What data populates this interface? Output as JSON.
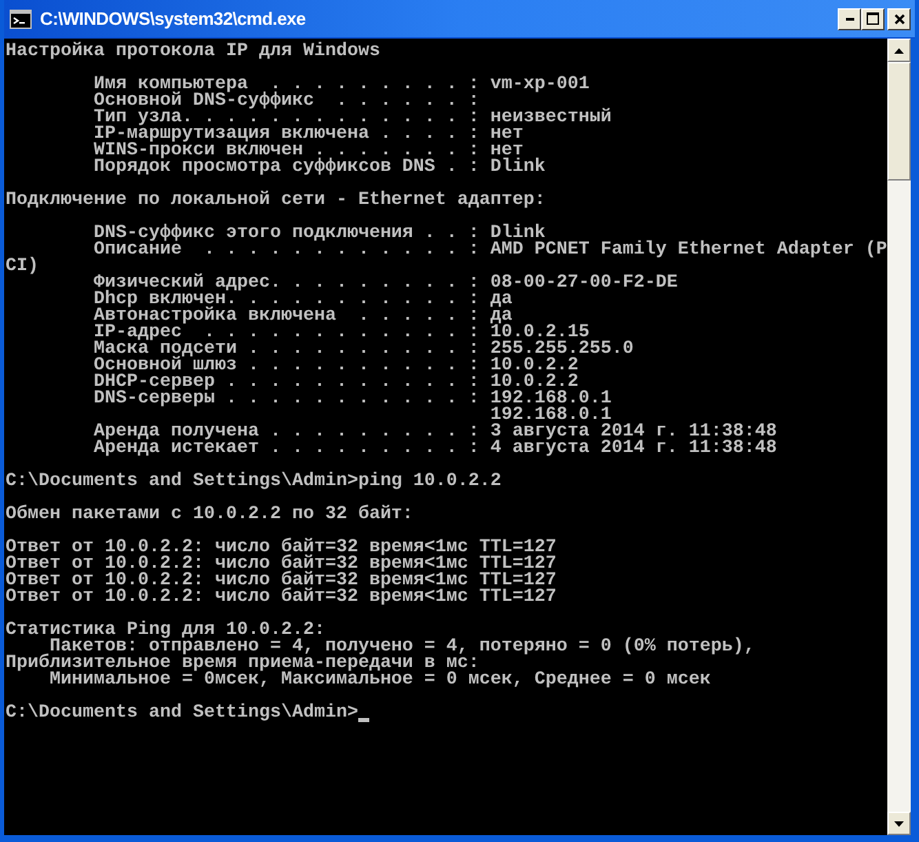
{
  "window": {
    "title": "C:\\WINDOWS\\system32\\cmd.exe"
  },
  "console": {
    "blocks": [
      [
        "Настройка протокола IP для Windows"
      ],
      [
        "        Имя компьютера  . . . . . . . . . : vm-xp-001",
        "        Основной DNS-суффикс  . . . . . . :",
        "        Тип узла. . . . . . . . . . . . . : неизвестный",
        "        IP-маршрутизация включена . . . . : нет",
        "        WINS-прокси включен . . . . . . . : нет",
        "        Порядок просмотра суффиксов DNS . : Dlink"
      ],
      [
        "Подключение по локальной сети - Ethernet адаптер:"
      ],
      [
        "        DNS-суффикс этого подключения . . : Dlink",
        "        Описание  . . . . . . . . . . . . : AMD PCNET Family Ethernet Adapter (P",
        "CI)",
        "        Физический адрес. . . . . . . . . : 08-00-27-00-F2-DE",
        "        Dhcp включен. . . . . . . . . . . : да",
        "        Автонастройка включена  . . . . . : да",
        "        IP-адрес  . . . . . . . . . . . . : 10.0.2.15",
        "        Маска подсети . . . . . . . . . . : 255.255.255.0",
        "        Основной шлюз . . . . . . . . . . : 10.0.2.2",
        "        DHCP-сервер . . . . . . . . . . . : 10.0.2.2",
        "        DNS-серверы . . . . . . . . . . . : 192.168.0.1",
        "                                            192.168.0.1",
        "        Аренда получена . . . . . . . . . : 3 августа 2014 г. 11:38:48",
        "        Аренда истекает . . . . . . . . . : 4 августа 2014 г. 11:38:48"
      ],
      [
        "C:\\Documents and Settings\\Admin>ping 10.0.2.2"
      ],
      [
        "Обмен пакетами с 10.0.2.2 по 32 байт:"
      ],
      [
        "Ответ от 10.0.2.2: число байт=32 время<1мс TTL=127",
        "Ответ от 10.0.2.2: число байт=32 время<1мс TTL=127",
        "Ответ от 10.0.2.2: число байт=32 время<1мс TTL=127",
        "Ответ от 10.0.2.2: число байт=32 время<1мс TTL=127"
      ],
      [
        "Статистика Ping для 10.0.2.2:",
        "    Пакетов: отправлено = 4, получено = 4, потеряно = 0 (0% потерь),",
        "Приблизительное время приема-передачи в мс:",
        "    Минимальное = 0мсек, Максимальное = 0 мсек, Среднее = 0 мсек"
      ],
      [
        "C:\\Documents and Settings\\Admin>"
      ]
    ]
  }
}
